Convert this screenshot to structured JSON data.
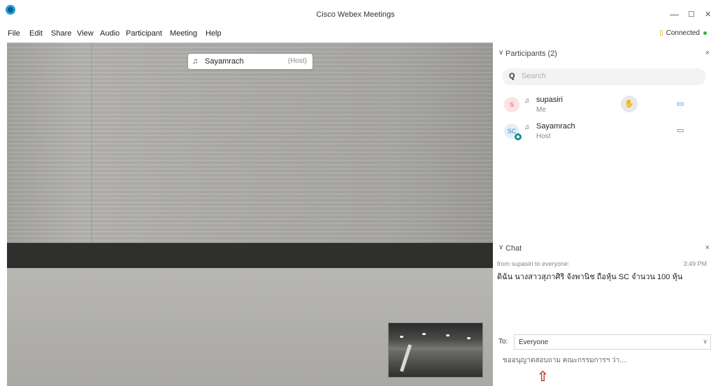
{
  "window": {
    "title": "Cisco Webex Meetings",
    "controls": {
      "minimize": "—",
      "maximize": "☐",
      "close": "✕"
    }
  },
  "menu": {
    "items": [
      "File",
      "Edit",
      "Share",
      "View",
      "Audio",
      "Participant",
      "Meeting",
      "Help"
    ],
    "status": "Connected"
  },
  "video": {
    "active_speaker": {
      "name": "Sayamrach",
      "role": "(Host)"
    }
  },
  "participants": {
    "title": "Participants (2)",
    "search_placeholder": "Search",
    "list": [
      {
        "initials": "S",
        "name": "supasiri",
        "role": "Me",
        "raise_hand": "✋",
        "camera": "▭"
      },
      {
        "initials": "SC",
        "name": "Sayamrach",
        "role": "Host",
        "camera": "▭"
      }
    ]
  },
  "chat": {
    "title": "Chat",
    "messages": [
      {
        "from": "from supasiri to everyone:",
        "time": "3:49 PM",
        "text": "ดิฉัน นางสาวสุภาศิริ จังพานิช ถือหุ้น SC จำนวน 100 หุ้น"
      }
    ],
    "to_label": "To:",
    "to_value": "Everyone",
    "compose_text": "ขออนุญาตสอบถาม คณะกรรมการฯ ว่า....",
    "arrow": "⇧"
  }
}
